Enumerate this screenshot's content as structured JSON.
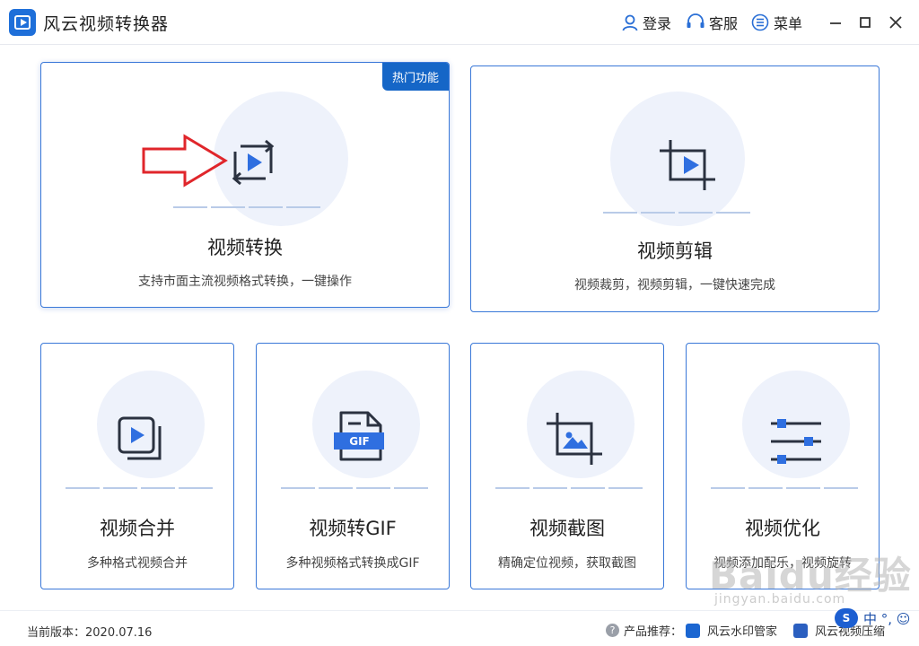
{
  "app": {
    "title": "风云视频转换器",
    "header_buttons": {
      "login": "登录",
      "service": "客服",
      "menu": "菜单"
    }
  },
  "cards": [
    {
      "title": "视频转换",
      "desc": "支持市面主流视频格式转换，一键操作",
      "badge": "热门功能",
      "icon": "video-convert-icon"
    },
    {
      "title": "视频剪辑",
      "desc": "视频裁剪，视频剪辑，一键快速完成",
      "icon": "video-crop-icon"
    },
    {
      "title": "视频合并",
      "desc": "多种格式视频合并",
      "icon": "video-merge-icon"
    },
    {
      "title": "视频转GIF",
      "desc": "多种视频格式转换成GIF",
      "icon": "gif-file-icon",
      "icon_label": "GIF"
    },
    {
      "title": "视频截图",
      "desc": "精确定位视频，获取截图",
      "icon": "screenshot-crop-icon"
    },
    {
      "title": "视频优化",
      "desc": "视频添加配乐，视频旋转",
      "icon": "sliders-icon"
    }
  ],
  "footer": {
    "version": "当前版本：2020.07.16",
    "recommend_label": "产品推荐：",
    "products": [
      "风云水印管家",
      "风云视频压缩"
    ]
  },
  "overlay": {
    "watermark": "Baidu经验",
    "watermark_sub": "jingyan.baidu.com",
    "ime_badge": "S",
    "ime_text": "中 °, ☺"
  },
  "colors": {
    "accent": "#1566c7",
    "border": "#3a78d8",
    "icon_blue": "#2f6fe0",
    "arrow_red": "#e0262b"
  }
}
